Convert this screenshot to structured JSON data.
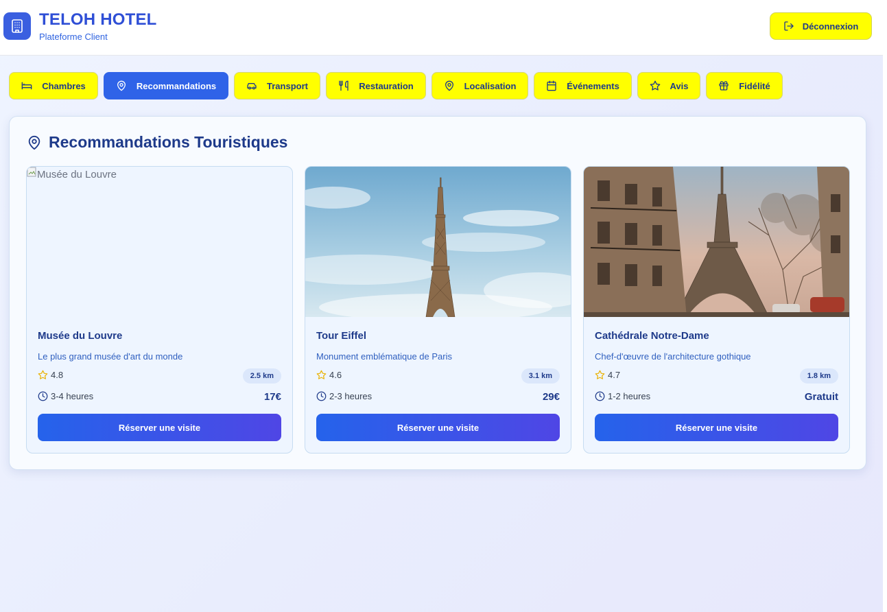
{
  "header": {
    "title": "TELOH HOTEL",
    "subtitle": "Plateforme Client",
    "logout_label": "Déconnexion",
    "logo_icon": "hotel-building-icon"
  },
  "tabs": [
    {
      "label": "Chambres",
      "icon": "bed-icon"
    },
    {
      "label": "Recommandations",
      "icon": "map-pin-icon",
      "active": true
    },
    {
      "label": "Transport",
      "icon": "car-icon"
    },
    {
      "label": "Restauration",
      "icon": "utensils-icon"
    },
    {
      "label": "Localisation",
      "icon": "map-pin-icon"
    },
    {
      "label": "Événements",
      "icon": "calendar-icon"
    },
    {
      "label": "Avis",
      "icon": "star-icon"
    },
    {
      "label": "Fidélité",
      "icon": "gift-icon"
    }
  ],
  "section": {
    "title": "Recommandations Touristiques"
  },
  "cards": [
    {
      "image_alt": "Musée du Louvre",
      "name": "Musée du Louvre",
      "description": "Le plus grand musée d'art du monde",
      "rating": "4.8",
      "distance": "2.5 km",
      "duration": "3-4 heures",
      "price": "17€",
      "button_label": "Réserver une visite"
    },
    {
      "image_alt": "Tour Eiffel",
      "name": "Tour Eiffel",
      "description": "Monument emblématique de Paris",
      "rating": "4.6",
      "distance": "3.1 km",
      "duration": "2-3 heures",
      "price": "29€",
      "button_label": "Réserver une visite"
    },
    {
      "image_alt": "Cathédrale Notre-Dame",
      "name": "Cathédrale Notre-Dame",
      "description": "Chef-d'œuvre de l'architecture gothique",
      "rating": "4.7",
      "distance": "1.8 km",
      "duration": "1-2 heures",
      "price": "Gratuit",
      "button_label": "Réserver une visite"
    }
  ],
  "colors": {
    "primary": "#2f63e8",
    "tab_bg": "#ffff00",
    "text_dark": "#1e3a8a",
    "star": "#eab308"
  }
}
